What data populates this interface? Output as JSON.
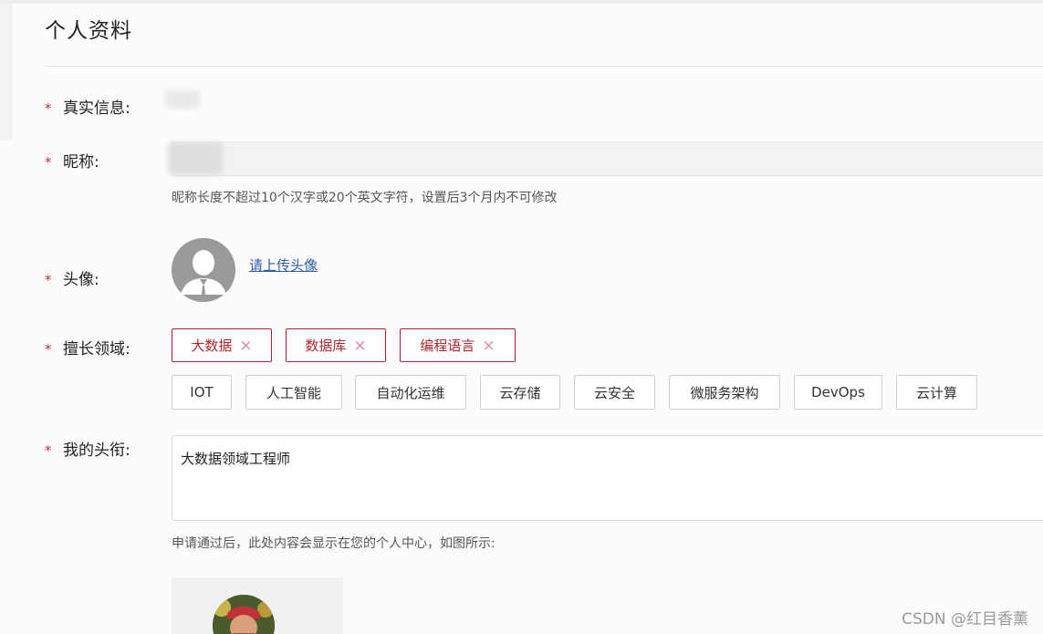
{
  "page": {
    "title": "个人资料"
  },
  "real_info": {
    "label": "真实信息:",
    "required_mark": "*"
  },
  "nickname": {
    "label": "昵称:",
    "required_mark": "*",
    "hint": "昵称长度不超过10个汉字或20个英文字符，设置后3个月内不可修改"
  },
  "avatar": {
    "label": "头像:",
    "required_mark": "*",
    "upload_link": "请上传头像",
    "icon": "default-user-avatar-icon"
  },
  "expertise": {
    "label": "擅长领域:",
    "required_mark": "*",
    "selected": [
      {
        "label": "大数据",
        "remove": "×"
      },
      {
        "label": "数据库",
        "remove": "×"
      },
      {
        "label": "编程语言",
        "remove": "×"
      }
    ],
    "options": [
      "IOT",
      "人工智能",
      "自动化运维",
      "云存储",
      "云安全",
      "微服务架构",
      "DevOps",
      "云计算"
    ],
    "accent_color": "#a8282e"
  },
  "headline": {
    "label": "我的头衔:",
    "required_mark": "*",
    "value": "大数据领域工程师",
    "hint": "申请通过后，此处内容会显示在您的个人中心，如图所示:"
  },
  "watermark": "CSDN @红目香薰"
}
